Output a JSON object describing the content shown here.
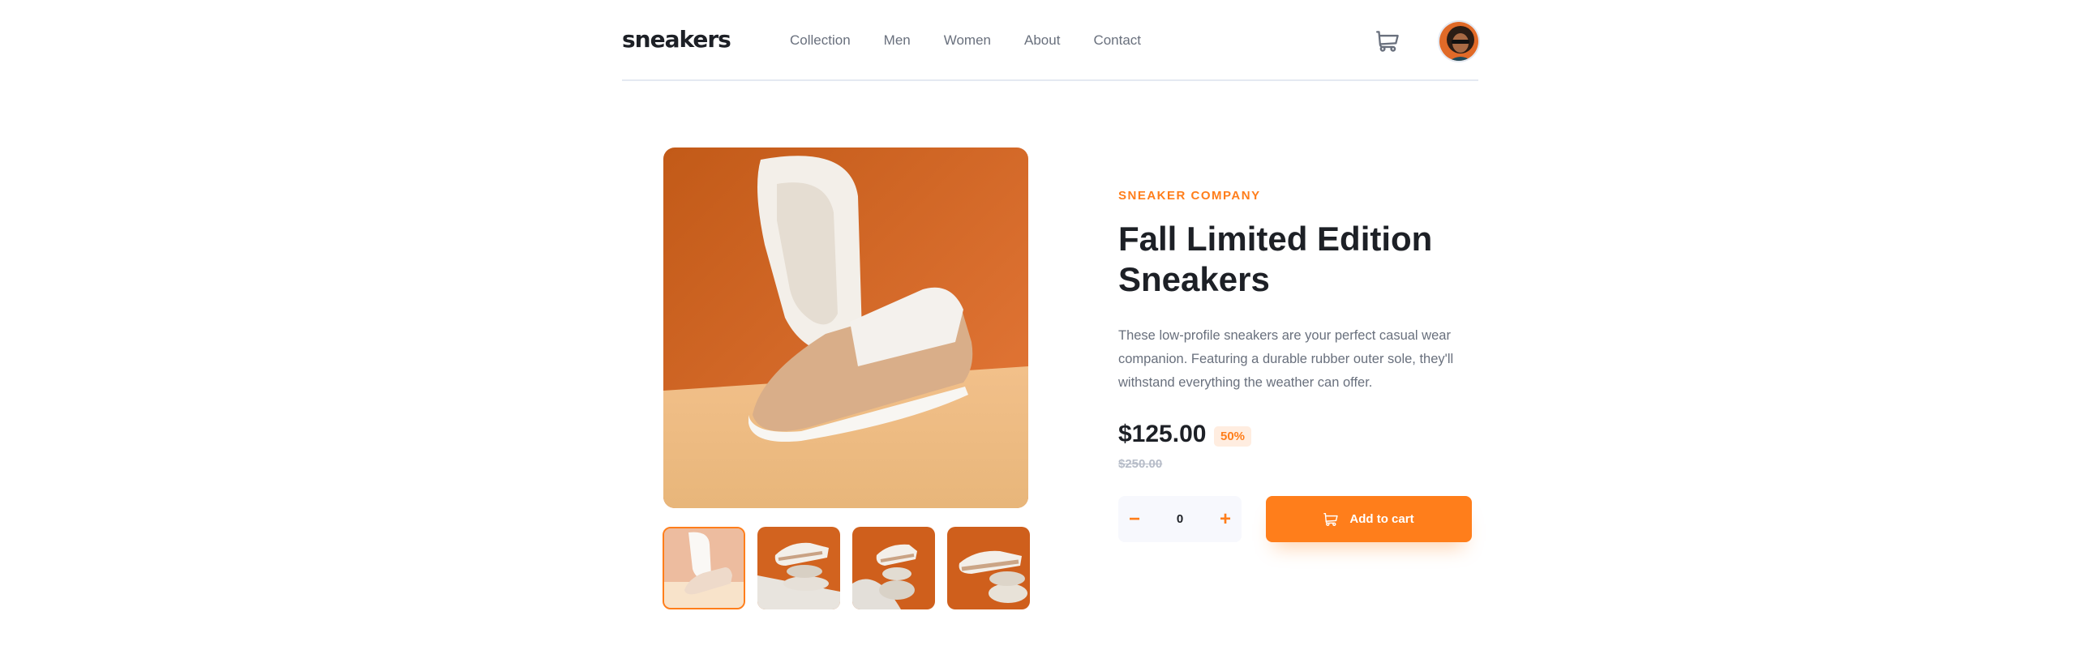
{
  "header": {
    "logo": "sneakers",
    "nav": [
      "Collection",
      "Men",
      "Women",
      "About",
      "Contact"
    ],
    "cart_icon": "cart-icon",
    "avatar_icon": "avatar"
  },
  "gallery": {
    "active_index": 0,
    "thumbnail_count": 4
  },
  "product": {
    "company": "SNEAKER COMPANY",
    "title": "Fall Limited Edition Sneakers",
    "description": "These low-profile sneakers are your perfect casual wear companion. Featuring a durable rubber outer sole, they'll withstand everything the weather can offer.",
    "price": "$125.00",
    "discount": "50%",
    "original_price": "$250.00"
  },
  "cart_controls": {
    "minus": "−",
    "quantity": "0",
    "plus": "+",
    "add_label": "Add to cart"
  },
  "colors": {
    "accent": "#ff7e1b",
    "accent_pale": "#ffede0",
    "text_dark": "#1d2026",
    "text_gray": "#69707d"
  }
}
